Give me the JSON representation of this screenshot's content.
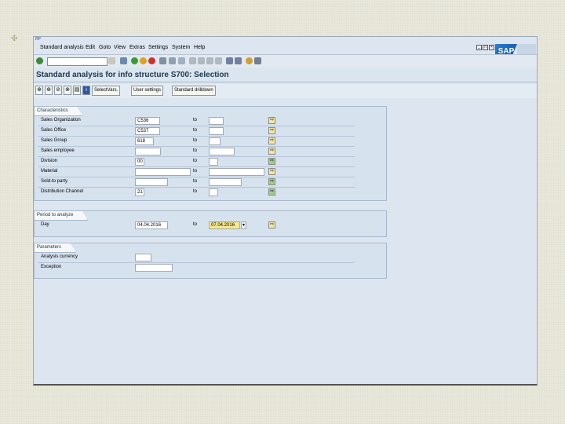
{
  "window": {
    "system_label": "RP",
    "menu": [
      {
        "text": "Standard analysis"
      },
      {
        "text": "Edit"
      },
      {
        "text": "Goto"
      },
      {
        "text": "View"
      },
      {
        "text": "Extras"
      },
      {
        "text": "Settings"
      },
      {
        "text": "System"
      },
      {
        "text": "Help"
      }
    ],
    "logo_text": "SAP"
  },
  "title": "Standard analysis for info structure S700: Selection",
  "app_toolbar": {
    "select_vars_label": "SelectVars.",
    "user_settings_label": "User settings",
    "standard_drilldown_label": "Standard drilldown"
  },
  "characteristics": {
    "title": "Characteristics",
    "to_label": "to",
    "rows": [
      {
        "label": "Sales Organization",
        "from": "C536",
        "to": ""
      },
      {
        "label": "Sales Office",
        "from": "C537",
        "to": ""
      },
      {
        "label": "Sales Group",
        "from": "618",
        "to": ""
      },
      {
        "label": "Sales employee",
        "from": "",
        "to": ""
      },
      {
        "label": "Division",
        "from": "00",
        "to": ""
      },
      {
        "label": "Material",
        "from": "",
        "to": ""
      },
      {
        "label": "Sold-to party",
        "from": "",
        "to": ""
      },
      {
        "label": "Distribution Channel",
        "from": "21",
        "to": ""
      }
    ]
  },
  "period": {
    "title": "Period to analyze",
    "to_label": "to",
    "row": {
      "label": "Day",
      "from": "04.04.2016",
      "to": "07.04.2016"
    }
  },
  "parameters": {
    "title": "Parameters",
    "rows": [
      {
        "label": "Analysis currency",
        "value": ""
      },
      {
        "label": "Exception",
        "value": ""
      }
    ]
  },
  "colors": {
    "window_bg": "#dde6f0",
    "group_bg": "#d6e2ee",
    "highlight_field": "#f7e88a"
  }
}
